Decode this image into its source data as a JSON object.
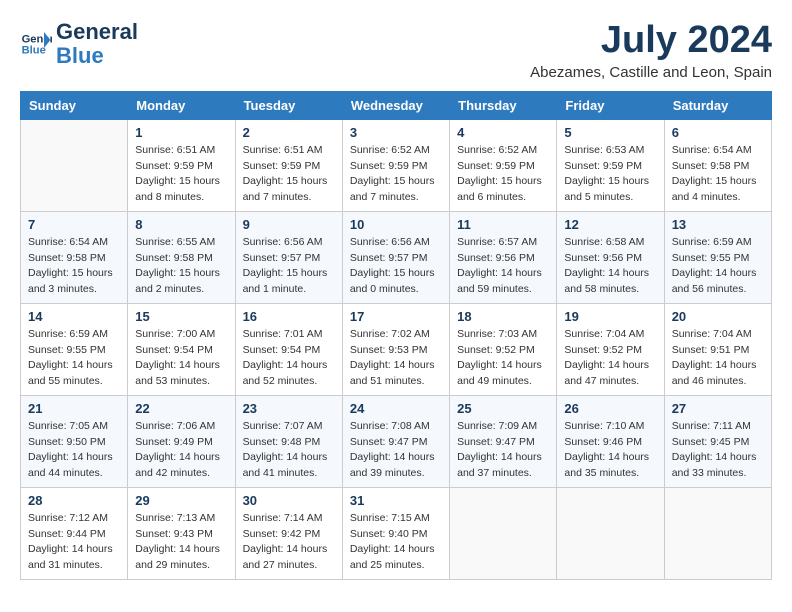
{
  "logo": {
    "line1": "General",
    "line2": "Blue"
  },
  "title": {
    "month_year": "July 2024",
    "location": "Abezames, Castille and Leon, Spain"
  },
  "weekdays": [
    "Sunday",
    "Monday",
    "Tuesday",
    "Wednesday",
    "Thursday",
    "Friday",
    "Saturday"
  ],
  "weeks": [
    [
      {
        "day": "",
        "sunrise": "",
        "sunset": "",
        "daylight": ""
      },
      {
        "day": "1",
        "sunrise": "Sunrise: 6:51 AM",
        "sunset": "Sunset: 9:59 PM",
        "daylight": "Daylight: 15 hours and 8 minutes."
      },
      {
        "day": "2",
        "sunrise": "Sunrise: 6:51 AM",
        "sunset": "Sunset: 9:59 PM",
        "daylight": "Daylight: 15 hours and 7 minutes."
      },
      {
        "day": "3",
        "sunrise": "Sunrise: 6:52 AM",
        "sunset": "Sunset: 9:59 PM",
        "daylight": "Daylight: 15 hours and 7 minutes."
      },
      {
        "day": "4",
        "sunrise": "Sunrise: 6:52 AM",
        "sunset": "Sunset: 9:59 PM",
        "daylight": "Daylight: 15 hours and 6 minutes."
      },
      {
        "day": "5",
        "sunrise": "Sunrise: 6:53 AM",
        "sunset": "Sunset: 9:59 PM",
        "daylight": "Daylight: 15 hours and 5 minutes."
      },
      {
        "day": "6",
        "sunrise": "Sunrise: 6:54 AM",
        "sunset": "Sunset: 9:58 PM",
        "daylight": "Daylight: 15 hours and 4 minutes."
      }
    ],
    [
      {
        "day": "7",
        "sunrise": "Sunrise: 6:54 AM",
        "sunset": "Sunset: 9:58 PM",
        "daylight": "Daylight: 15 hours and 3 minutes."
      },
      {
        "day": "8",
        "sunrise": "Sunrise: 6:55 AM",
        "sunset": "Sunset: 9:58 PM",
        "daylight": "Daylight: 15 hours and 2 minutes."
      },
      {
        "day": "9",
        "sunrise": "Sunrise: 6:56 AM",
        "sunset": "Sunset: 9:57 PM",
        "daylight": "Daylight: 15 hours and 1 minute."
      },
      {
        "day": "10",
        "sunrise": "Sunrise: 6:56 AM",
        "sunset": "Sunset: 9:57 PM",
        "daylight": "Daylight: 15 hours and 0 minutes."
      },
      {
        "day": "11",
        "sunrise": "Sunrise: 6:57 AM",
        "sunset": "Sunset: 9:56 PM",
        "daylight": "Daylight: 14 hours and 59 minutes."
      },
      {
        "day": "12",
        "sunrise": "Sunrise: 6:58 AM",
        "sunset": "Sunset: 9:56 PM",
        "daylight": "Daylight: 14 hours and 58 minutes."
      },
      {
        "day": "13",
        "sunrise": "Sunrise: 6:59 AM",
        "sunset": "Sunset: 9:55 PM",
        "daylight": "Daylight: 14 hours and 56 minutes."
      }
    ],
    [
      {
        "day": "14",
        "sunrise": "Sunrise: 6:59 AM",
        "sunset": "Sunset: 9:55 PM",
        "daylight": "Daylight: 14 hours and 55 minutes."
      },
      {
        "day": "15",
        "sunrise": "Sunrise: 7:00 AM",
        "sunset": "Sunset: 9:54 PM",
        "daylight": "Daylight: 14 hours and 53 minutes."
      },
      {
        "day": "16",
        "sunrise": "Sunrise: 7:01 AM",
        "sunset": "Sunset: 9:54 PM",
        "daylight": "Daylight: 14 hours and 52 minutes."
      },
      {
        "day": "17",
        "sunrise": "Sunrise: 7:02 AM",
        "sunset": "Sunset: 9:53 PM",
        "daylight": "Daylight: 14 hours and 51 minutes."
      },
      {
        "day": "18",
        "sunrise": "Sunrise: 7:03 AM",
        "sunset": "Sunset: 9:52 PM",
        "daylight": "Daylight: 14 hours and 49 minutes."
      },
      {
        "day": "19",
        "sunrise": "Sunrise: 7:04 AM",
        "sunset": "Sunset: 9:52 PM",
        "daylight": "Daylight: 14 hours and 47 minutes."
      },
      {
        "day": "20",
        "sunrise": "Sunrise: 7:04 AM",
        "sunset": "Sunset: 9:51 PM",
        "daylight": "Daylight: 14 hours and 46 minutes."
      }
    ],
    [
      {
        "day": "21",
        "sunrise": "Sunrise: 7:05 AM",
        "sunset": "Sunset: 9:50 PM",
        "daylight": "Daylight: 14 hours and 44 minutes."
      },
      {
        "day": "22",
        "sunrise": "Sunrise: 7:06 AM",
        "sunset": "Sunset: 9:49 PM",
        "daylight": "Daylight: 14 hours and 42 minutes."
      },
      {
        "day": "23",
        "sunrise": "Sunrise: 7:07 AM",
        "sunset": "Sunset: 9:48 PM",
        "daylight": "Daylight: 14 hours and 41 minutes."
      },
      {
        "day": "24",
        "sunrise": "Sunrise: 7:08 AM",
        "sunset": "Sunset: 9:47 PM",
        "daylight": "Daylight: 14 hours and 39 minutes."
      },
      {
        "day": "25",
        "sunrise": "Sunrise: 7:09 AM",
        "sunset": "Sunset: 9:47 PM",
        "daylight": "Daylight: 14 hours and 37 minutes."
      },
      {
        "day": "26",
        "sunrise": "Sunrise: 7:10 AM",
        "sunset": "Sunset: 9:46 PM",
        "daylight": "Daylight: 14 hours and 35 minutes."
      },
      {
        "day": "27",
        "sunrise": "Sunrise: 7:11 AM",
        "sunset": "Sunset: 9:45 PM",
        "daylight": "Daylight: 14 hours and 33 minutes."
      }
    ],
    [
      {
        "day": "28",
        "sunrise": "Sunrise: 7:12 AM",
        "sunset": "Sunset: 9:44 PM",
        "daylight": "Daylight: 14 hours and 31 minutes."
      },
      {
        "day": "29",
        "sunrise": "Sunrise: 7:13 AM",
        "sunset": "Sunset: 9:43 PM",
        "daylight": "Daylight: 14 hours and 29 minutes."
      },
      {
        "day": "30",
        "sunrise": "Sunrise: 7:14 AM",
        "sunset": "Sunset: 9:42 PM",
        "daylight": "Daylight: 14 hours and 27 minutes."
      },
      {
        "day": "31",
        "sunrise": "Sunrise: 7:15 AM",
        "sunset": "Sunset: 9:40 PM",
        "daylight": "Daylight: 14 hours and 25 minutes."
      },
      {
        "day": "",
        "sunrise": "",
        "sunset": "",
        "daylight": ""
      },
      {
        "day": "",
        "sunrise": "",
        "sunset": "",
        "daylight": ""
      },
      {
        "day": "",
        "sunrise": "",
        "sunset": "",
        "daylight": ""
      }
    ]
  ]
}
